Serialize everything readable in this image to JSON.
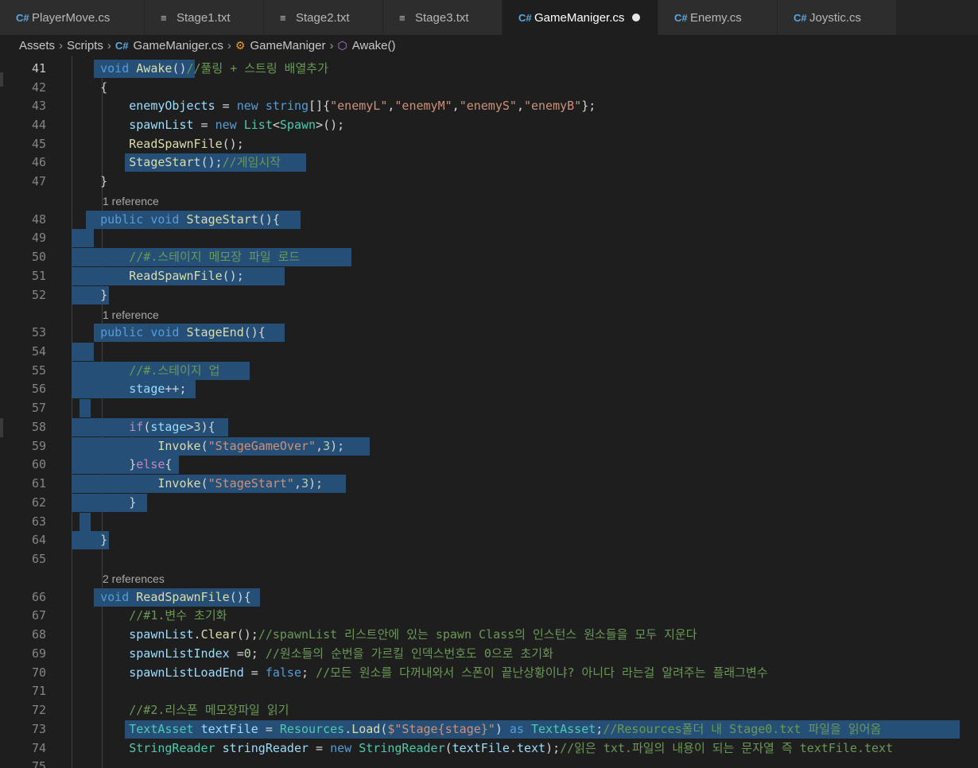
{
  "tabs": [
    {
      "label": "PlayerMove.cs",
      "icon": "csharp-icon"
    },
    {
      "label": "Stage1.txt",
      "icon": "text-file-icon"
    },
    {
      "label": "Stage2.txt",
      "icon": "text-file-icon"
    },
    {
      "label": "Stage3.txt",
      "icon": "text-file-icon"
    },
    {
      "label": "GameManiger.cs",
      "icon": "csharp-icon"
    },
    {
      "label": "Enemy.cs",
      "icon": "csharp-icon"
    },
    {
      "label": "Joystic.cs",
      "icon": "csharp-icon"
    }
  ],
  "breadcrumb": {
    "assets": "Assets",
    "scripts": "Scripts",
    "file": "GameManiger.cs",
    "class": "GameManiger",
    "method": "Awake()"
  },
  "codelens": {
    "l48": "1 reference",
    "l53": "1 reference",
    "l66": "2 references"
  },
  "lines": [
    {
      "n": "41",
      "code": "    void Awake()//풀링 + 스트링 배열추가"
    },
    {
      "n": "42",
      "code": "    {"
    },
    {
      "n": "43",
      "code": "        enemyObjects = new string[]{\"enemyL\",\"enemyM\",\"enemyS\",\"enemyB\"};"
    },
    {
      "n": "44",
      "code": "        spawnList = new List<Spawn>();"
    },
    {
      "n": "45",
      "code": "        ReadSpawnFile();"
    },
    {
      "n": "46",
      "code": "        StageStart();//게임시작"
    },
    {
      "n": "47",
      "code": "    }"
    },
    {
      "n": "48",
      "code": "    public void StageStart(){"
    },
    {
      "n": "49",
      "code": ""
    },
    {
      "n": "50",
      "code": "        //#.스테이지 메모장 파일 로드"
    },
    {
      "n": "51",
      "code": "        ReadSpawnFile();"
    },
    {
      "n": "52",
      "code": "    }"
    },
    {
      "n": "53",
      "code": "    public void StageEnd(){"
    },
    {
      "n": "54",
      "code": ""
    },
    {
      "n": "55",
      "code": "        //#.스테이지 업"
    },
    {
      "n": "56",
      "code": "        stage++;"
    },
    {
      "n": "57",
      "code": ""
    },
    {
      "n": "58",
      "code": "        if(stage>3){"
    },
    {
      "n": "59",
      "code": "            Invoke(\"StageGameOver\",3);"
    },
    {
      "n": "60",
      "code": "        }else{"
    },
    {
      "n": "61",
      "code": "            Invoke(\"StageStart\",3);"
    },
    {
      "n": "62",
      "code": "        }"
    },
    {
      "n": "63",
      "code": ""
    },
    {
      "n": "64",
      "code": "    }"
    },
    {
      "n": "65",
      "code": ""
    },
    {
      "n": "66",
      "code": "    void ReadSpawnFile(){"
    },
    {
      "n": "67",
      "code": "        //#1.변수 초기화"
    },
    {
      "n": "68",
      "code": "        spawnList.Clear();//spawnList 리스트안에 있는 spawn Class의 인스턴스 원소들을 모두 지운다"
    },
    {
      "n": "69",
      "code": "        spawnListIndex =0; //원소들의 순번을 가르킬 인덱스번호도 0으로 초기화"
    },
    {
      "n": "70",
      "code": "        spawnListLoadEnd = false; //모든 원소를 다꺼내와서 스폰이 끝난상황이냐? 아니다 라는걸 알려주는 플래그변수"
    },
    {
      "n": "71",
      "code": ""
    },
    {
      "n": "72",
      "code": "        //#2.리스폰 메모장파일 읽기"
    },
    {
      "n": "73",
      "code": "        TextAsset textFile = Resources.Load($\"Stage{stage}\") as TextAsset;//Resources폴더 내 Stage0.txt 파일을 읽어옴"
    },
    {
      "n": "74",
      "code": "        StringReader stringReader = new StringReader(textFile.text);//읽은 txt.파일의 내용이 되는 문자열 즉 textFile.text"
    },
    {
      "n": "75",
      "code": ""
    }
  ],
  "colors": {
    "editor_bg": "#1e1e1e",
    "selection": "#264f78",
    "keyword": "#569cd6",
    "type": "#4ec9b0",
    "function": "#dcdcaa",
    "variable": "#9cdcfe",
    "string": "#ce9178",
    "comment": "#6a9955"
  }
}
